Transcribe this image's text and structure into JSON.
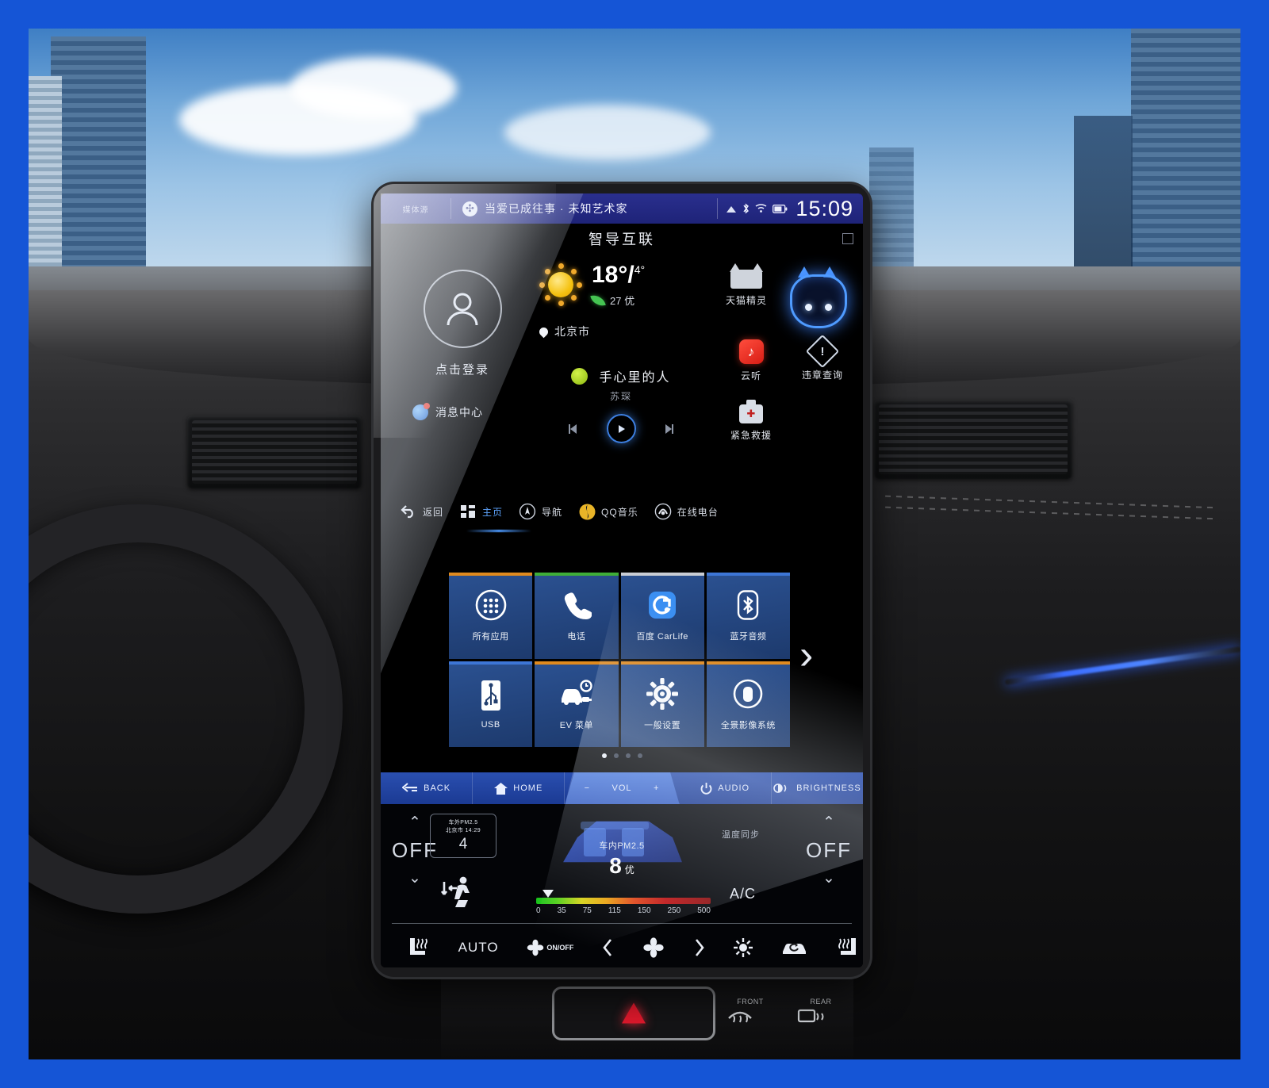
{
  "statusbar": {
    "source_label": "媒体源",
    "bt_icon": "bluetooth-icon",
    "now_playing": "当爱已成往事 · 未知艺术家",
    "icons": [
      "signal-4g-icon",
      "bluetooth-icon",
      "wifi-icon",
      "battery-icon"
    ],
    "time": "15:09"
  },
  "header": {
    "title": "智导互联"
  },
  "profile": {
    "label": "点击登录",
    "avatar_icon": "user-avatar-icon"
  },
  "messages": {
    "label": "消息中心",
    "icon": "message-center-icon",
    "badge": true
  },
  "weather": {
    "sun_icon": "sun-icon",
    "temp_high": "18",
    "temp_unit": "°/",
    "temp_low": "4°",
    "aqi_icon": "leaf-icon",
    "aqi_text": "27 优",
    "location_icon": "location-pin-icon",
    "location": "北京市"
  },
  "music": {
    "icon": "music-source-icon",
    "title": "手心里的人",
    "artist": "苏琛",
    "prev_icon": "previous-track-icon",
    "play_icon": "play-icon",
    "next_icon": "next-track-icon"
  },
  "side_apps": [
    {
      "label": "天猫精灵",
      "icon": "tmall-genie-icon"
    },
    {
      "label": "",
      "icon": "voice-assistant-avatar-icon"
    },
    {
      "label": "云听",
      "icon": "yunting-radio-icon"
    },
    {
      "label": "违章查询",
      "icon": "violation-query-icon"
    },
    {
      "label": "紧急救援",
      "icon": "emergency-rescue-icon"
    }
  ],
  "shortcutbar": [
    {
      "label": "返回",
      "icon": "back-arrow-icon",
      "active": false
    },
    {
      "label": "主页",
      "icon": "home-grid-icon",
      "active": true
    },
    {
      "label": "导航",
      "icon": "navigation-icon",
      "active": false
    },
    {
      "label": "QQ音乐",
      "icon": "qq-music-icon",
      "active": false
    },
    {
      "label": "在线电台",
      "icon": "online-radio-icon",
      "active": false
    }
  ],
  "app_grid": {
    "tiles": [
      {
        "label": "所有应用",
        "icon": "all-apps-icon",
        "accent": "#e08a1e"
      },
      {
        "label": "电话",
        "icon": "phone-icon",
        "accent": "#3fae38"
      },
      {
        "label": "百度 CarLife",
        "icon": "carlife-icon",
        "accent": "#c9cdd4"
      },
      {
        "label": "蓝牙音频",
        "icon": "bluetooth-audio-icon",
        "accent": "#3d76d6"
      },
      {
        "label": "USB",
        "icon": "usb-icon",
        "accent": "#3d76d6"
      },
      {
        "label": "EV 菜单",
        "icon": "ev-menu-icon",
        "accent": "#e08a1e"
      },
      {
        "label": "一般设置",
        "icon": "settings-gear-icon",
        "accent": "#e08a1e"
      },
      {
        "label": "全景影像系统",
        "icon": "surround-view-icon",
        "accent": "#e08a1e"
      }
    ],
    "next_page_icon": "chevron-right-icon",
    "page_count": 4,
    "page_active": 1
  },
  "keybar": [
    {
      "label": "BACK",
      "icon": "back-key-icon"
    },
    {
      "label": "HOME",
      "icon": "home-key-icon"
    },
    {
      "label": "VOL",
      "icon": "volume-key-icon",
      "minus": "−",
      "plus": "+"
    },
    {
      "label": "AUDIO",
      "icon": "power-audio-icon"
    },
    {
      "label": "BRIGHTNESS",
      "icon": "brightness-icon"
    }
  ],
  "climate": {
    "left_temp": {
      "up_icon": "chevron-up-icon",
      "value": "OFF",
      "down_icon": "chevron-down-icon"
    },
    "right_temp": {
      "up_icon": "chevron-up-icon",
      "value": "OFF",
      "down_icon": "chevron-down-icon"
    },
    "outside_pm": {
      "line1": "车外PM2.5",
      "line2": "北京市 14:29",
      "value": "4"
    },
    "inside_pm": {
      "label": "车内PM2.5",
      "value": "8",
      "unit": "优"
    },
    "scale_values": [
      "0",
      "35",
      "75",
      "115",
      "150",
      "250",
      "500"
    ],
    "sync_label": "温度同步",
    "ac_label": "A/C",
    "airflow_icon": "airflow-seat-icon",
    "buttons": [
      {
        "label": "",
        "icon": "driver-seat-heater-icon"
      },
      {
        "label": "AUTO",
        "icon": "auto-climate-icon"
      },
      {
        "label": "ON/OFF",
        "icon": "fan-onoff-icon"
      },
      {
        "label": "",
        "icon": "fan-decrease-icon"
      },
      {
        "label": "",
        "icon": "fan-speed-icon"
      },
      {
        "label": "",
        "icon": "fan-increase-icon"
      },
      {
        "label": "",
        "icon": "rear-defrost-icon"
      },
      {
        "label": "",
        "icon": "air-recirculation-icon"
      },
      {
        "label": "",
        "icon": "passenger-seat-heater-icon"
      }
    ]
  },
  "dashboard": {
    "hazard_icon": "hazard-triangle-icon",
    "front_defrost_label": "FRONT",
    "rear_defrost_label": "REAR"
  }
}
